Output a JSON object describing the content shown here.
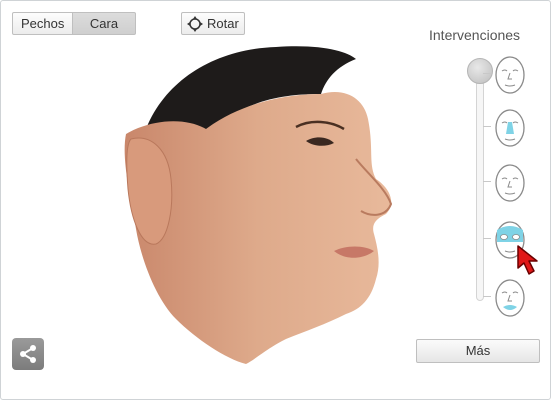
{
  "toolbar": {
    "mode_left": "Pechos",
    "mode_right": "Cara",
    "rotate_label": "Rotar"
  },
  "panel": {
    "title": "Intervenciones",
    "slider_value": 0,
    "options": [
      {
        "icon": "face-outline-icon",
        "highlight": "none",
        "selected": false
      },
      {
        "icon": "face-nose-highlight-icon",
        "highlight": "nose",
        "selected": false
      },
      {
        "icon": "face-outline-icon",
        "highlight": "none",
        "selected": false
      },
      {
        "icon": "face-eyes-highlight-icon",
        "highlight": "eyes",
        "selected": true
      },
      {
        "icon": "face-lips-highlight-icon",
        "highlight": "lips",
        "selected": false
      }
    ],
    "more_label": "Más"
  },
  "colors": {
    "highlight": "#7fd3e6",
    "cursor": "#e01818"
  }
}
